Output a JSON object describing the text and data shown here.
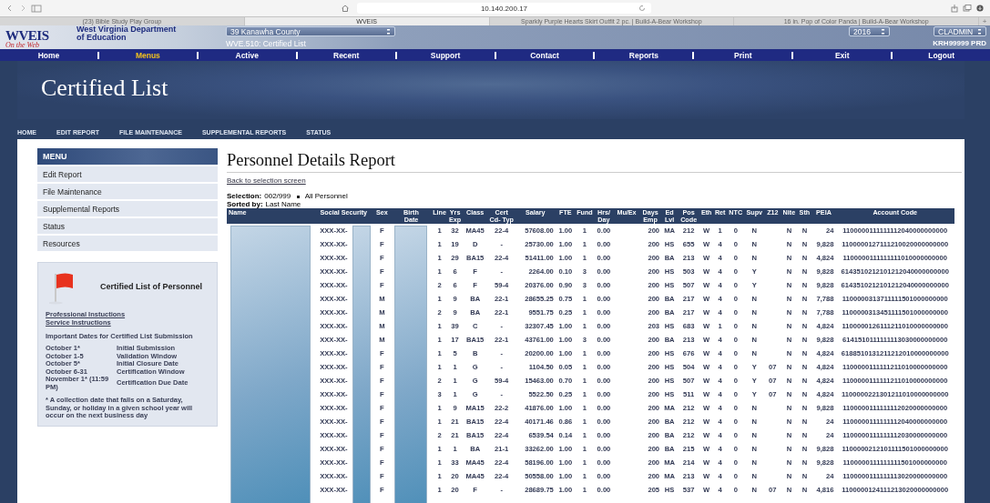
{
  "browser": {
    "address": "10.140.200.17",
    "tabs": [
      {
        "title": "(23) Bible Study Play Group",
        "selected": false
      },
      {
        "title": "WVEIS",
        "selected": true
      },
      {
        "title": "Sparkly Purple Hearts Skirt Outfit 2 pc. | Build-A-Bear Workshop",
        "selected": false
      },
      {
        "title": "16 in. Pop of Color Panda | Build-A-Bear Workshop",
        "selected": false
      }
    ],
    "new_tab": "+"
  },
  "header": {
    "logo": "WVEIS",
    "logo_tagline": "On the Web",
    "agency": "West Virginia Department of Education",
    "county": "39 Kanawha County",
    "app": "WVE.510: Certified List",
    "year": "2016",
    "user": "CLADMIN",
    "session": "KRH99999 PRD"
  },
  "nav": [
    {
      "label": "Home",
      "selected": false
    },
    {
      "label": "Menus",
      "selected": true
    },
    {
      "label": "Active",
      "selected": false
    },
    {
      "label": "Recent",
      "selected": false
    },
    {
      "label": "Support",
      "selected": false
    },
    {
      "label": "Contact",
      "selected": false
    },
    {
      "label": "Reports",
      "selected": false
    },
    {
      "label": "Print",
      "selected": false
    },
    {
      "label": "Exit",
      "selected": false
    },
    {
      "label": "Logout",
      "selected": false
    }
  ],
  "banner_title": "Certified List",
  "subnav": [
    "HOME",
    "EDIT REPORT",
    "FILE MAINTENANCE",
    "SUPPLEMENTAL REPORTS",
    "STATUS"
  ],
  "sidebar": {
    "title": "MENU",
    "items": [
      "Edit Report",
      "File Maintenance",
      "Supplemental Reports",
      "Status",
      "Resources"
    ],
    "info": {
      "title": "Certified List of Personnel",
      "links": [
        "Professional Instuctions",
        "Service Instructions"
      ],
      "dates_heading": "Important Dates for Certified List Submission",
      "dates": [
        {
          "date": "October 1*",
          "event": "Initial Submission"
        },
        {
          "date": "October 1-5",
          "event": "Validation Window"
        },
        {
          "date": "October 5*",
          "event": "Initial Closure Date"
        },
        {
          "date": "October 6-31",
          "event": "Certification Window"
        },
        {
          "date": "November 1* (11:59 PM)",
          "event": "Certification Due Date"
        }
      ],
      "footnote": "* A collection date that falls on a Saturday, Sunday, or holiday in a given school year will occur on the next business day"
    }
  },
  "report": {
    "title": "Personnel Details Report",
    "back_link": "Back to selection screen",
    "selection_label": "Selection:",
    "selection_value": "002/999",
    "selection_note": "All Personnel",
    "sorted_label": "Sorted by:",
    "sorted_value": "Last Name",
    "table": {
      "columns": [
        {
          "label": [
            "Name"
          ],
          "kind": "redacted"
        },
        {
          "label": [
            "Social Security"
          ],
          "kind": "ssn"
        },
        {
          "label": [
            "Sex"
          ],
          "kind": "text"
        },
        {
          "label": [
            "Birth",
            "Date"
          ],
          "kind": "redacted"
        },
        {
          "label": [
            "Line"
          ],
          "kind": "text"
        },
        {
          "label": [
            "Yrs",
            "Exp"
          ],
          "kind": "text"
        },
        {
          "label": [
            "Class"
          ],
          "kind": "text"
        },
        {
          "label": [
            "Cert",
            "Cd- Typ"
          ],
          "kind": "text"
        },
        {
          "label": [
            "Salary"
          ],
          "kind": "num"
        },
        {
          "label": [
            "FTE"
          ],
          "kind": "text"
        },
        {
          "label": [
            "Fund"
          ],
          "kind": "text"
        },
        {
          "label": [
            "Hrs/",
            "Day"
          ],
          "kind": "text"
        },
        {
          "label": [
            "Mu/Ex"
          ],
          "kind": "text"
        },
        {
          "label": [
            "Days",
            "Emp"
          ],
          "kind": "num"
        },
        {
          "label": [
            "Ed",
            "Lvl"
          ],
          "kind": "text"
        },
        {
          "label": [
            "Pos",
            "Code"
          ],
          "kind": "text"
        },
        {
          "label": [
            "Eth"
          ],
          "kind": "text"
        },
        {
          "label": [
            "Ret"
          ],
          "kind": "text"
        },
        {
          "label": [
            "NTC"
          ],
          "kind": "text"
        },
        {
          "label": [
            "Supv"
          ],
          "kind": "text"
        },
        {
          "label": [
            "Z12"
          ],
          "kind": "text"
        },
        {
          "label": [
            "Nite"
          ],
          "kind": "text"
        },
        {
          "label": [
            "Sth"
          ],
          "kind": "text"
        },
        {
          "label": [
            "PEIA"
          ],
          "kind": "num"
        },
        {
          "label": [
            "Account Code"
          ],
          "kind": "text"
        }
      ],
      "rows": [
        {
          "cells": [
            "",
            "XXX-XX-",
            "F",
            "",
            "1",
            "32",
            "MA45",
            "22-4",
            "57608.00",
            "1.00",
            "1",
            "0.00",
            "",
            "200",
            "MA",
            "212",
            "W",
            "1",
            "0",
            "N",
            "",
            "N",
            "N",
            "24",
            "1100000111111112040000000000"
          ]
        },
        {
          "cells": [
            "",
            "XXX-XX-",
            "F",
            "",
            "1",
            "19",
            "D",
            "-",
            "25730.00",
            "1.00",
            "1",
            "0.00",
            "",
            "200",
            "HS",
            "655",
            "W",
            "4",
            "0",
            "N",
            "",
            "N",
            "N",
            "9,828",
            "1100000127111210020000000000"
          ]
        },
        {
          "cells": [
            "",
            "XXX-XX-",
            "F",
            "",
            "1",
            "29",
            "BA15",
            "22-4",
            "51411.00",
            "1.00",
            "1",
            "0.00",
            "",
            "200",
            "BA",
            "213",
            "W",
            "4",
            "0",
            "N",
            "",
            "N",
            "N",
            "4,824",
            "1100000111111111010000000000"
          ]
        },
        {
          "cells": [
            "",
            "XXX-XX-",
            "F",
            "",
            "1",
            "6",
            "F",
            "-",
            "2264.00",
            "0.10",
            "3",
            "0.00",
            "",
            "200",
            "HS",
            "503",
            "W",
            "4",
            "0",
            "Y",
            "",
            "N",
            "N",
            "9,828",
            "6143510212101212040000000000"
          ]
        },
        {
          "cells": [
            "",
            "XXX-XX-",
            "F",
            "",
            "2",
            "6",
            "F",
            "59-4",
            "20376.00",
            "0.90",
            "3",
            "0.00",
            "",
            "200",
            "HS",
            "507",
            "W",
            "4",
            "0",
            "Y",
            "",
            "N",
            "N",
            "9,828",
            "6143510212101212040000000000"
          ]
        },
        {
          "cells": [
            "",
            "XXX-XX-",
            "M",
            "",
            "1",
            "9",
            "BA",
            "22-1",
            "28655.25",
            "0.75",
            "1",
            "0.00",
            "",
            "200",
            "BA",
            "217",
            "W",
            "4",
            "0",
            "N",
            "",
            "N",
            "N",
            "7,788",
            "1100000313711111501000000000"
          ]
        },
        {
          "cells": [
            "",
            "XXX-XX-",
            "M",
            "",
            "2",
            "9",
            "BA",
            "22-1",
            "9551.75",
            "0.25",
            "1",
            "0.00",
            "",
            "200",
            "BA",
            "217",
            "W",
            "4",
            "0",
            "N",
            "",
            "N",
            "N",
            "7,788",
            "1100000313451111501000000000"
          ]
        },
        {
          "cells": [
            "",
            "XXX-XX-",
            "M",
            "",
            "1",
            "39",
            "C",
            "-",
            "32307.45",
            "1.00",
            "1",
            "0.00",
            "",
            "203",
            "HS",
            "683",
            "W",
            "1",
            "0",
            "N",
            "",
            "N",
            "N",
            "4,824",
            "1100000126111211010000000000"
          ]
        },
        {
          "cells": [
            "",
            "XXX-XX-",
            "M",
            "",
            "1",
            "17",
            "BA15",
            "22-1",
            "43761.00",
            "1.00",
            "3",
            "0.00",
            "",
            "200",
            "BA",
            "213",
            "W",
            "4",
            "0",
            "N",
            "",
            "N",
            "N",
            "9,828",
            "6141510111111113030000000000"
          ]
        },
        {
          "cells": [
            "",
            "XXX-XX-",
            "F",
            "",
            "1",
            "5",
            "B",
            "-",
            "20200.00",
            "1.00",
            "1",
            "0.00",
            "",
            "200",
            "HS",
            "676",
            "W",
            "4",
            "0",
            "N",
            "",
            "N",
            "N",
            "4,824",
            "6188510131211212010000000000"
          ]
        },
        {
          "cells": [
            "",
            "XXX-XX-",
            "F",
            "",
            "1",
            "1",
            "G",
            "-",
            "1104.50",
            "0.05",
            "1",
            "0.00",
            "",
            "200",
            "HS",
            "504",
            "W",
            "4",
            "0",
            "Y",
            "07",
            "N",
            "N",
            "4,824",
            "1100000111111211010000000000"
          ]
        },
        {
          "cells": [
            "",
            "XXX-XX-",
            "F",
            "",
            "2",
            "1",
            "G",
            "59-4",
            "15463.00",
            "0.70",
            "1",
            "0.00",
            "",
            "200",
            "HS",
            "507",
            "W",
            "4",
            "0",
            "Y",
            "07",
            "N",
            "N",
            "4,824",
            "1100000111111211010000000000"
          ]
        },
        {
          "cells": [
            "",
            "XXX-XX-",
            "F",
            "",
            "3",
            "1",
            "G",
            "-",
            "5522.50",
            "0.25",
            "1",
            "0.00",
            "",
            "200",
            "HS",
            "511",
            "W",
            "4",
            "0",
            "Y",
            "07",
            "N",
            "N",
            "4,824",
            "1100000221301211010000000000"
          ]
        },
        {
          "cells": [
            "",
            "XXX-XX-",
            "F",
            "",
            "1",
            "9",
            "MA15",
            "22-2",
            "41876.00",
            "1.00",
            "1",
            "0.00",
            "",
            "200",
            "MA",
            "212",
            "W",
            "4",
            "0",
            "N",
            "",
            "N",
            "N",
            "9,828",
            "1100000111111112020000000000"
          ]
        },
        {
          "cells": [
            "",
            "XXX-XX-",
            "F",
            "",
            "1",
            "21",
            "BA15",
            "22-4",
            "40171.46",
            "0.86",
            "1",
            "0.00",
            "",
            "200",
            "BA",
            "212",
            "W",
            "4",
            "0",
            "N",
            "",
            "N",
            "N",
            "24",
            "1100000111111112040000000000"
          ]
        },
        {
          "cells": [
            "",
            "XXX-XX-",
            "F",
            "",
            "2",
            "21",
            "BA15",
            "22-4",
            "6539.54",
            "0.14",
            "1",
            "0.00",
            "",
            "200",
            "BA",
            "212",
            "W",
            "4",
            "0",
            "N",
            "",
            "N",
            "N",
            "24",
            "1100000111111112030000000000"
          ]
        },
        {
          "cells": [
            "",
            "XXX-XX-",
            "F",
            "",
            "1",
            "1",
            "BA",
            "21-1",
            "33262.00",
            "1.00",
            "1",
            "0.00",
            "",
            "200",
            "BA",
            "215",
            "W",
            "4",
            "0",
            "N",
            "",
            "N",
            "N",
            "9,828",
            "1100000212101111501000000000"
          ]
        },
        {
          "cells": [
            "",
            "XXX-XX-",
            "F",
            "",
            "1",
            "33",
            "MA45",
            "22-4",
            "58196.00",
            "1.00",
            "1",
            "0.00",
            "",
            "200",
            "MA",
            "214",
            "W",
            "4",
            "0",
            "N",
            "",
            "N",
            "N",
            "9,828",
            "1100000111111111501000000000"
          ]
        },
        {
          "cells": [
            "",
            "XXX-XX-",
            "F",
            "",
            "1",
            "20",
            "MA45",
            "22-4",
            "50558.00",
            "1.00",
            "1",
            "0.00",
            "",
            "200",
            "MA",
            "213",
            "W",
            "4",
            "0",
            "N",
            "",
            "N",
            "N",
            "24",
            "1100000111111113020000000000"
          ]
        },
        {
          "cells": [
            "",
            "XXX-XX-",
            "F",
            "",
            "1",
            "20",
            "F",
            "-",
            "28689.75",
            "1.00",
            "1",
            "0.00",
            "",
            "205",
            "HS",
            "537",
            "W",
            "4",
            "0",
            "N",
            "07",
            "N",
            "N",
            "4,816",
            "1100000124111213020000000000"
          ]
        }
      ]
    }
  }
}
